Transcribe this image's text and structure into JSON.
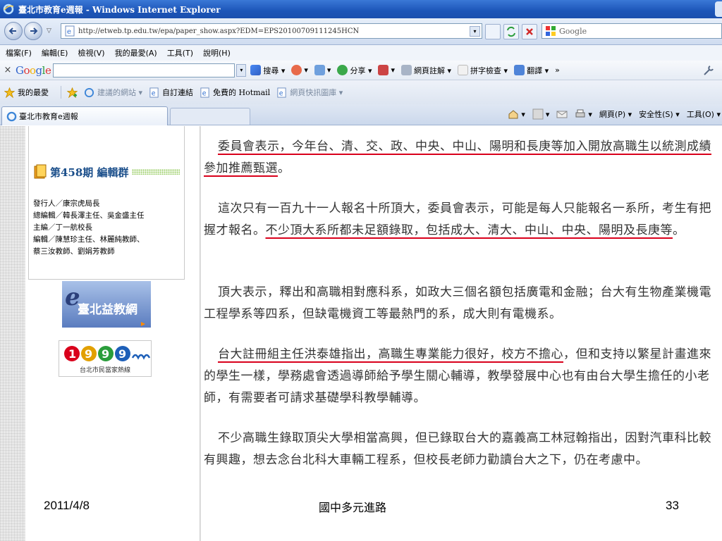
{
  "window": {
    "title": "臺北市教育e週報 - Windows Internet Explorer",
    "url": "http://etweb.tp.edu.tw/epa/paper_show.aspx?EDM=EPS20100709111245HCN",
    "search_placeholder": "Google"
  },
  "menu": [
    "檔案(F)",
    "編輯(E)",
    "檢視(V)",
    "我的最愛(A)",
    "工具(T)",
    "說明(H)"
  ],
  "google_toolbar": {
    "close": "×",
    "logo": "Google",
    "items": [
      "搜尋 ▾",
      "▾",
      "▾",
      "分享 ▾",
      "▾",
      "網頁註解 ▾",
      "拼字檢查 ▾",
      "翻譯 ▾",
      "»"
    ]
  },
  "favorites_bar": {
    "favorites": "我的最愛",
    "suggested": "建議的網站 ▾",
    "custom_links": "自訂連結",
    "hotmail": "免費的 Hotmail",
    "web_slice": "網頁快訊圖庫 ▾"
  },
  "tab": {
    "label": "臺北市教育e週報"
  },
  "command_bar": [
    "▾",
    "▾",
    "▾",
    "網頁(P) ▾",
    "安全性(S) ▾",
    "工具(O) ▾"
  ],
  "sidebar": {
    "issue_title": "第458期 編輯群",
    "lines": [
      "發行人／康宗虎局長",
      "總編輯／韓長澤主任、吳金盛主任",
      "主編／丁一航校長",
      "編輯／陳慧珍主任、林麗純教師、",
      "蔡三汝教師、劉娟芳教師"
    ],
    "logo1_text": "臺北益教網",
    "logo2_text": "1999",
    "logo2_caption": "台北市民當家熱線"
  },
  "article": {
    "p1_underlined": "委員會表示，今年台、清、交、政、中央、中山、陽明和長庚等加入開放高職生以統測成績參加推薦甄選",
    "p1_tail": "。",
    "p2_head": "這次只有一百九十一人報名十所頂大，委員會表示，可能是每人只能報名一系所，考生有把握才報名。",
    "p2_underlined": "不少頂大系所都未足額錄取，包括成大、清大、中山、中央、陽明及長庚等",
    "p2_tail": "。",
    "p3": "頂大表示，釋出和高職相對應科系，如政大三個名額包括廣電和金融；台大有生物產業機電工程學系等四系，但缺電機資工等最熱門的系，成大則有電機系。",
    "p4_underlined": "台大註冊組主任洪泰雄指出，高職生專業能力很好，校方不擔心",
    "p4_tail": "，但和支持以繁星計畫進來的學生一樣，學務處會透過導師給予學生關心輔導，教學發展中心也有由台大學生擔任的小老師，有需要者可請求基礎學科教學輔導。",
    "p5": "不少高職生錄取頂尖大學相當高興，但已錄取台大的嘉義高工林冠翰指出，因對汽車科比較有興趣，想去念台北科大車輛工程系，但校長老師力勸讀台大之下，仍在考慮中。"
  },
  "footer": {
    "date": "2011/4/8",
    "title": "國中多元進路",
    "page": "33"
  },
  "colors": {
    "underline": "#d9001b",
    "titlebar": "#1c55b8",
    "sidebar_title": "#1a4e8a"
  }
}
